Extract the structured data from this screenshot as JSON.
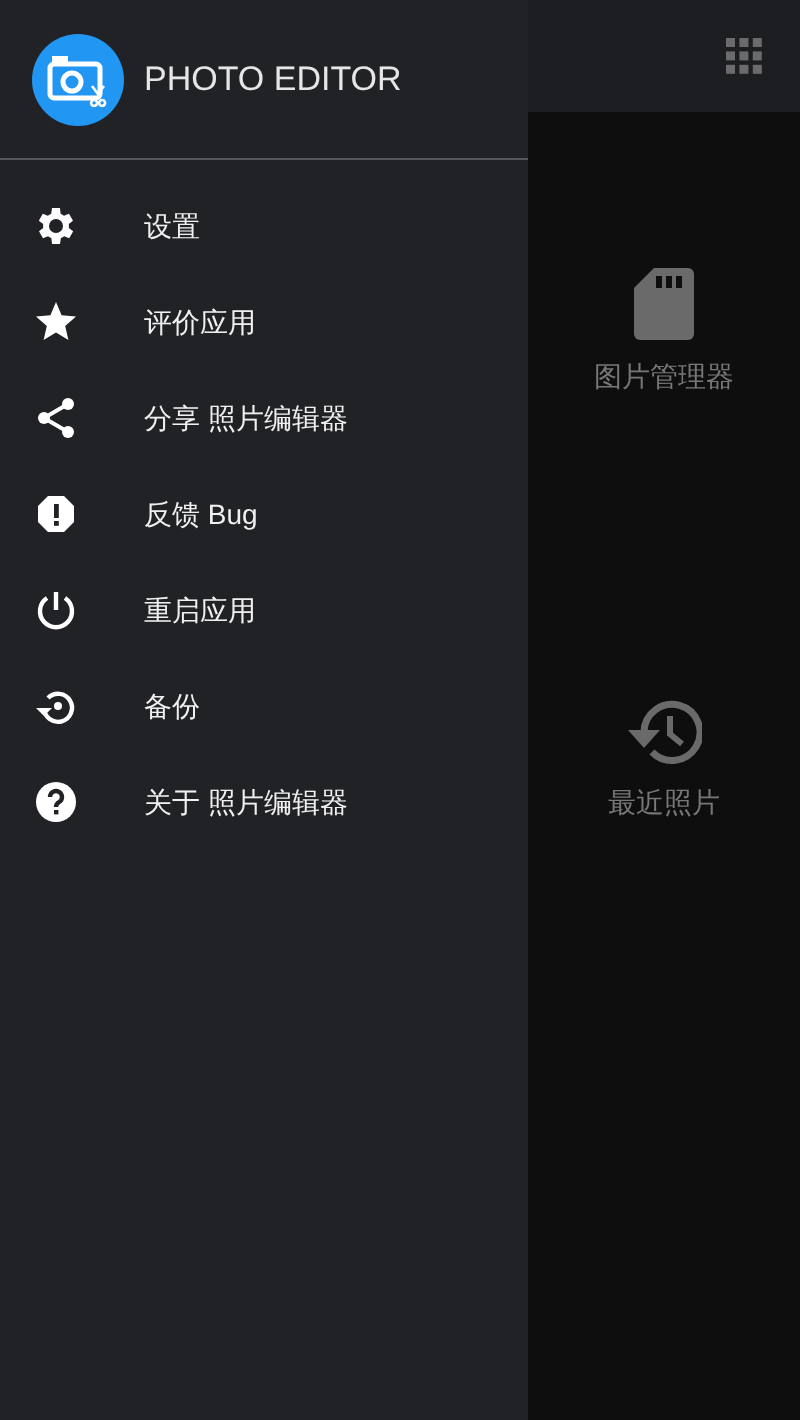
{
  "drawer": {
    "title": "PHOTO EDITOR",
    "items": [
      {
        "label": "设置"
      },
      {
        "label": "评价应用"
      },
      {
        "label": "分享 照片编辑器"
      },
      {
        "label": "反馈 Bug"
      },
      {
        "label": "重启应用"
      },
      {
        "label": "备份"
      },
      {
        "label": "关于 照片编辑器"
      }
    ]
  },
  "main": {
    "tiles": [
      {
        "label": "图片管理器"
      },
      {
        "label": "最近照片"
      }
    ]
  }
}
